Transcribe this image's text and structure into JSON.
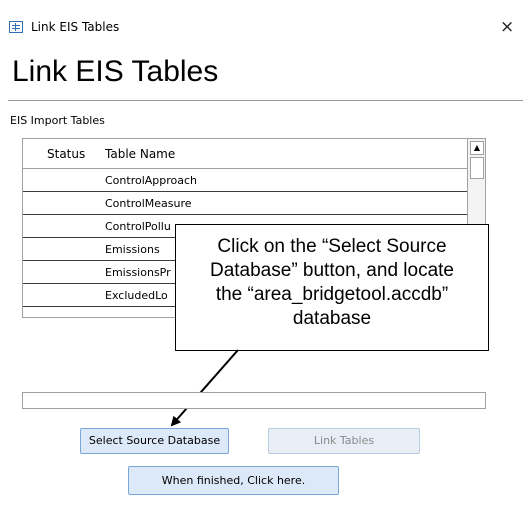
{
  "window": {
    "title": "Link EIS Tables",
    "close_glyph": "×",
    "icon": "table-form-icon"
  },
  "form": {
    "header": "Link EIS Tables",
    "group_label": "EIS Import Tables"
  },
  "grid": {
    "columns": [
      "Status",
      "Table Name"
    ],
    "rows": [
      {
        "status": "",
        "name": "ControlApproach"
      },
      {
        "status": "",
        "name": "ControlMeasure"
      },
      {
        "status": "",
        "name": "ControlPollu"
      },
      {
        "status": "",
        "name": "Emissions"
      },
      {
        "status": "",
        "name": "EmissionsPr"
      },
      {
        "status": "",
        "name": "ExcludedLo"
      }
    ],
    "scroll_up_glyph": "▲"
  },
  "callout": {
    "lines": [
      "Click on the “Select Source",
      "Database” button, and locate",
      "the “area_bridgetool.accdb”",
      "database"
    ]
  },
  "buttons": {
    "select_source": "Select Source Database",
    "link_tables": "Link Tables",
    "finished": "When finished, Click here."
  }
}
